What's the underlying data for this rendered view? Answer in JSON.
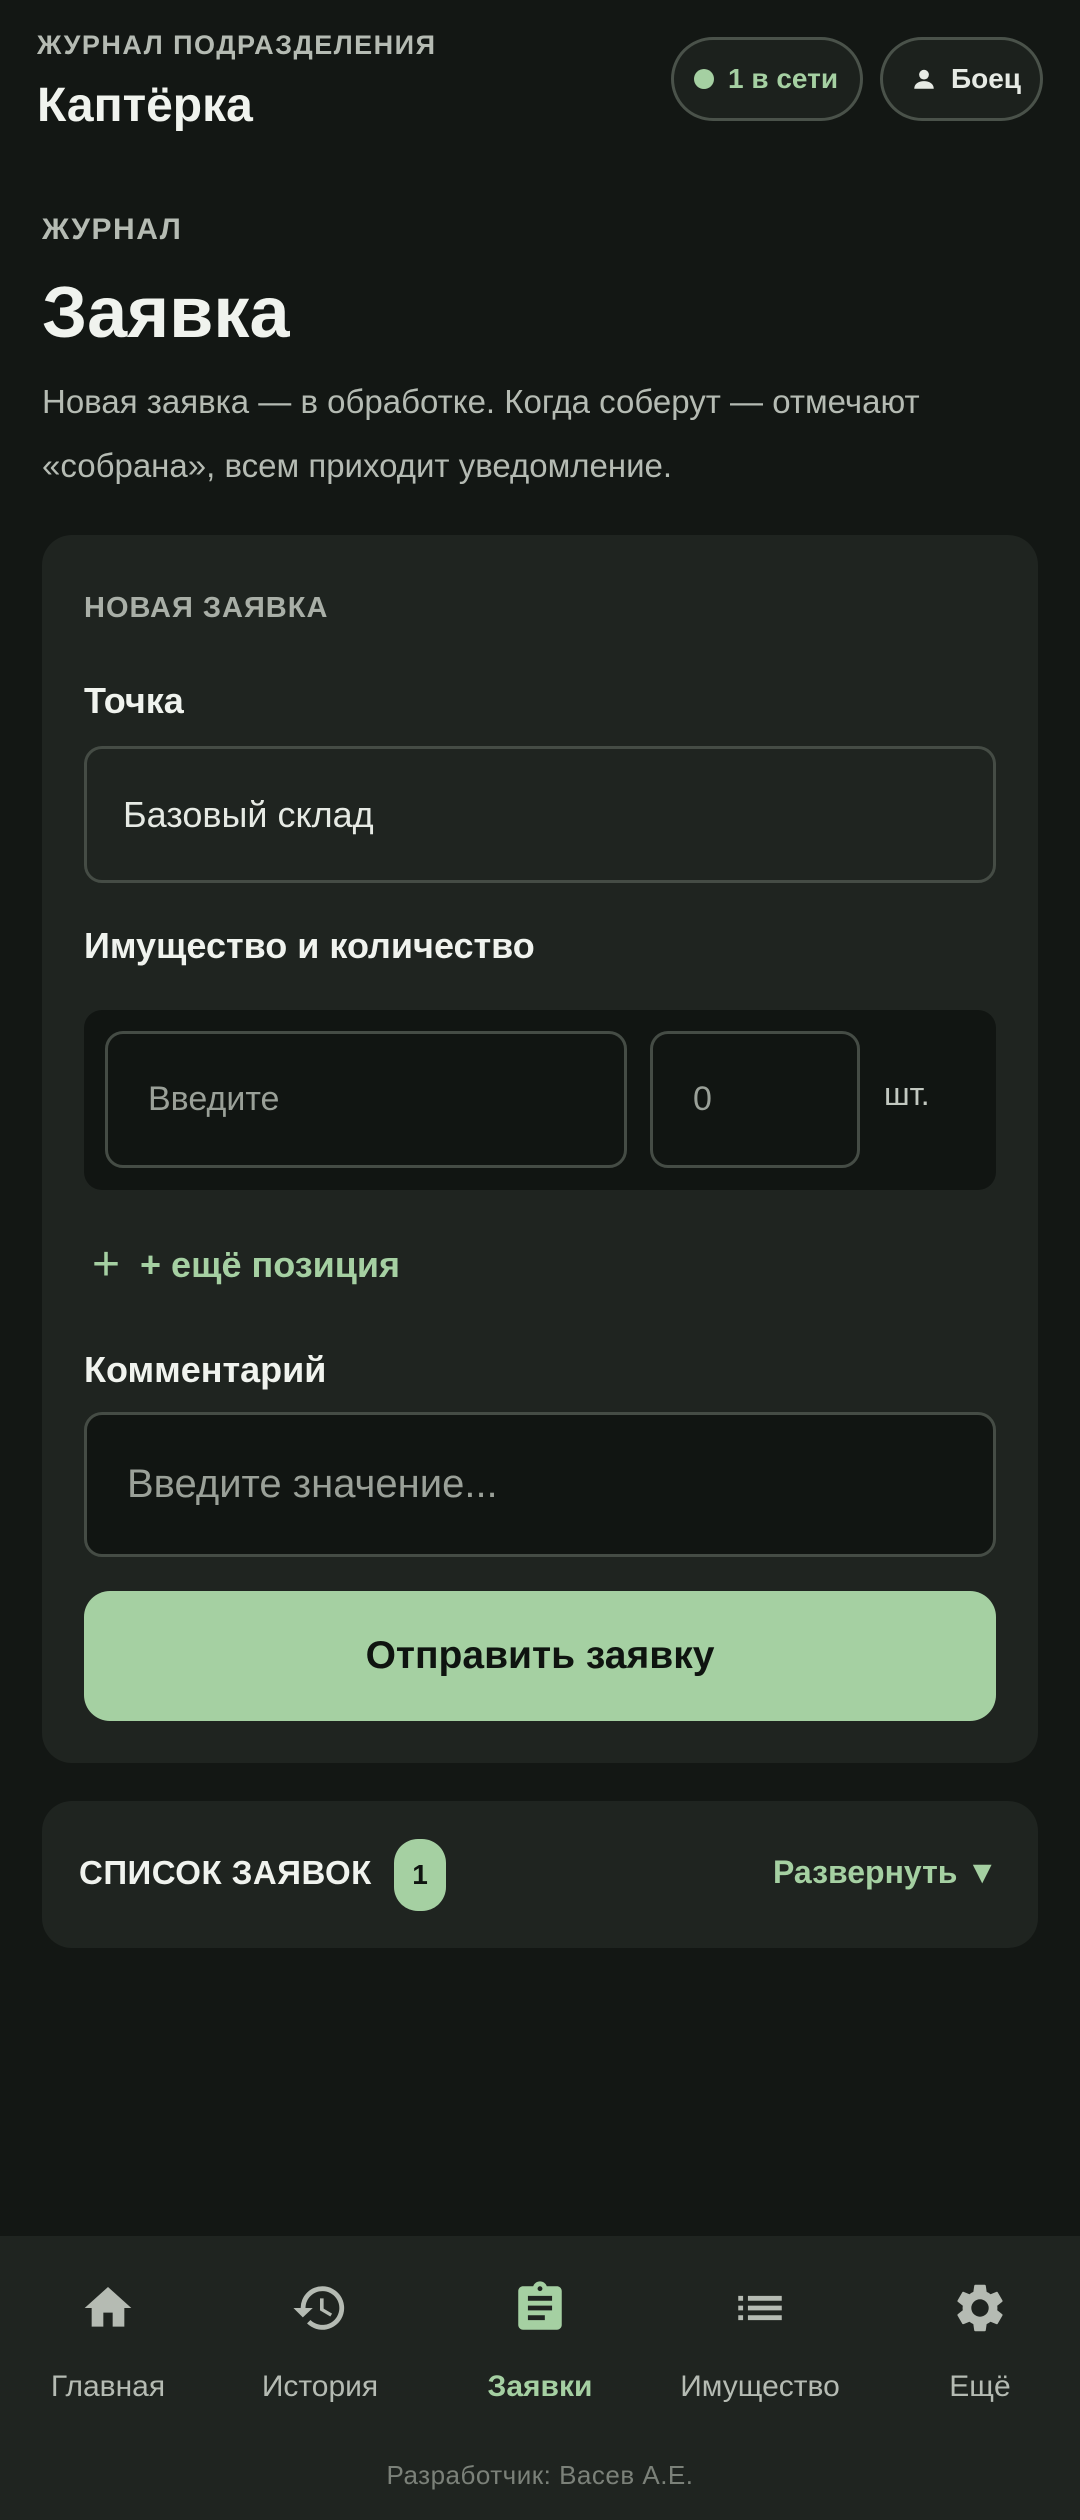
{
  "header": {
    "subtitle": "ЖУРНАЛ ПОДРАЗДЕЛЕНИЯ",
    "title": "Каптёрка",
    "online_label": "1 в сети",
    "role_label": "Боец"
  },
  "section": {
    "eyebrow": "ЖУРНАЛ",
    "title": "Заявка",
    "description": "Новая заявка — в обработке. Когда соберут — отмечают «собрана», всем приходит уведомление."
  },
  "form": {
    "eyebrow": "НОВАЯ ЗАЯВКА",
    "point_label": "Точка",
    "point_value": "Базовый склад",
    "items_label": "Имущество и количество",
    "item_placeholder": "Введите",
    "qty_placeholder": "0",
    "unit": "шт.",
    "add_position": "+ ещё позиция",
    "comment_label": "Комментарий",
    "comment_placeholder": "Введите значение...",
    "submit": "Отправить заявку"
  },
  "list": {
    "title": "СПИСОК ЗАЯВОК",
    "count": "1",
    "expand": "Развернуть ▼"
  },
  "nav": {
    "items": [
      {
        "label": "Главная",
        "icon": "home-icon"
      },
      {
        "label": "История",
        "icon": "history-icon"
      },
      {
        "label": "Заявки",
        "icon": "clipboard-icon",
        "active": true
      },
      {
        "label": "Имущество",
        "icon": "list-icon"
      },
      {
        "label": "Ещё",
        "icon": "gear-icon"
      }
    ]
  },
  "footer": "Разработчик: Васев А.Е.",
  "colors": {
    "background": "#131714",
    "surface": "#1f2420",
    "accent": "#a5d0a2",
    "muted_text": "#b5bbb3"
  }
}
